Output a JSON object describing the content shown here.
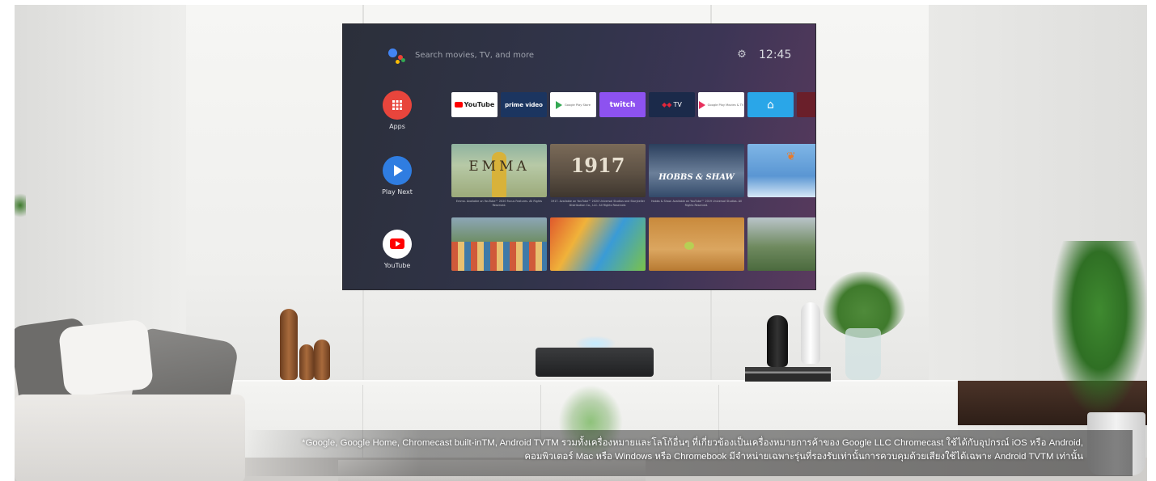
{
  "screen": {
    "search_placeholder": "Search movies, TV, and more",
    "clock": "12:45",
    "side_nav": [
      {
        "label": "Apps",
        "icon": "apps-grid-icon",
        "color": "#e8453c"
      },
      {
        "label": "Play Next",
        "icon": "play-icon",
        "color": "#2f7de1"
      },
      {
        "label": "YouTube",
        "icon": "youtube-icon",
        "color": "#ffffff"
      }
    ],
    "apps": [
      {
        "label": "YouTube",
        "bg": "#ffffff",
        "fg": "#222222"
      },
      {
        "label": "prime video",
        "bg": "#1b3560",
        "fg": "#ffffff"
      },
      {
        "label": "Google Play Store",
        "bg": "#ffffff",
        "fg": "#555555"
      },
      {
        "label": "twitch",
        "bg": "#8d52f0",
        "fg": "#ffffff"
      },
      {
        "label": "TV",
        "bg": "#1b2a4a",
        "fg": "#ffffff"
      },
      {
        "label": "Google Play Movies & TV",
        "bg": "#ffffff",
        "fg": "#555555"
      },
      {
        "label": "home",
        "bg": "#2aa6e8",
        "fg": "#ffffff"
      }
    ],
    "row1_titles": [
      "EMMA",
      "1917",
      "HOBBS & SHAW",
      ""
    ],
    "row1_captions": [
      "Emma. Available on YouTube™ 2020 Focus Features. All Rights Reserved.",
      "1917. Available on YouTube™ 2020 Universal Studios and Storyteller Distribution Co., LLC. All Rights Reserved.",
      "Hobbs & Shaw. Available on YouTube™ 2019 Universal Studios. All Rights Reserved.",
      ""
    ]
  },
  "disclaimer": {
    "line1": "*Google, Google Home, Chromecast built-inTM, Android TVTM รวมทั้งเครื่องหมายและโลโก้อื่นๆ ที่เกี่ยวข้องเป็นเครื่องหมายการค้าของ Google LLC Chromecast ใช้ได้กับอุปกรณ์ iOS หรือ Android,",
    "line2": "คอมพิวเตอร์ Mac หรือ Windows หรือ Chromebook มีจำหน่ายเฉพาะรุ่นที่รองรับเท่านั้นการควบคุมด้วยเสียงใช้ได้เฉพาะ Android TVTM เท่านั้น"
  }
}
